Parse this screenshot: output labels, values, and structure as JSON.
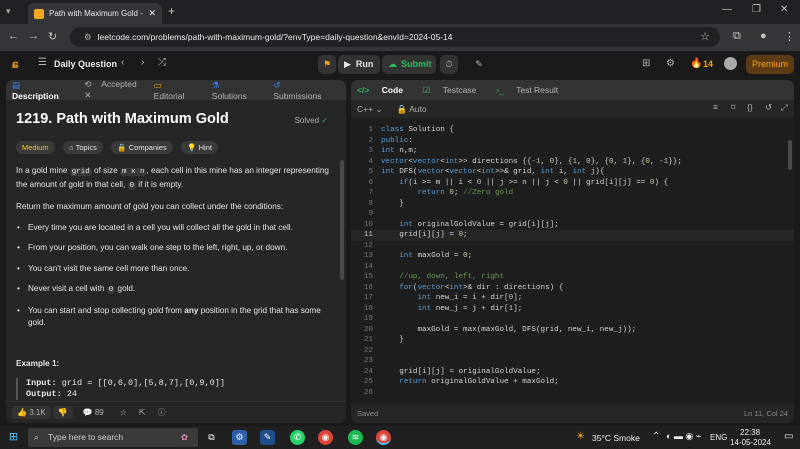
{
  "browser": {
    "tab_title": "Path with Maximum Gold - Leetc",
    "url": "leetcode.com/problems/path-with-maximum-gold/?envType=daily-question&envId=2024-05-14"
  },
  "header": {
    "daily_question": "Daily Question",
    "run": "Run",
    "submit": "Submit",
    "streak": "14",
    "premium": "Premium"
  },
  "left": {
    "tabs": [
      "Description",
      "Accepted",
      "Editorial",
      "Solutions",
      "Submissions"
    ],
    "title": "1219. Path with Maximum Gold",
    "solved": "Solved",
    "chips": [
      "Medium",
      "Topics",
      "Companies",
      "Hint"
    ],
    "para1_a": "In a gold mine ",
    "para1_grid": "grid",
    "para1_b": " of size ",
    "para1_mxn": "m x n",
    "para1_c": ", each cell in this mine has an integer representing the amount of gold in that cell, ",
    "para1_zero": "0",
    "para1_d": " if it is empty.",
    "para2": "Return the maximum amount of gold you can collect under the conditions:",
    "bullets": [
      "Every time you are located in a cell you will collect all the gold in that cell.",
      "From your position, you can walk one step to the left, right, up, or down.",
      "You can't visit the same cell more than once."
    ],
    "bullet4_a": "Never visit a cell with ",
    "bullet4_zero": "0",
    "bullet4_b": " gold.",
    "bullet5_a": "You can start and stop collecting gold from ",
    "bullet5_any": "any",
    "bullet5_b": " position in the grid that has some gold.",
    "example_title": "Example 1:",
    "example_input_label": "Input:",
    "example_input": " grid = [[0,6,0],[5,8,7],[0,9,0]]",
    "example_output_label": "Output:",
    "example_output": " 24",
    "likes": "3.1K",
    "comments": "89"
  },
  "right": {
    "tabs": [
      "Code",
      "Testcase",
      "Test Result"
    ],
    "language": "C++",
    "mode": "Auto",
    "status": "Saved",
    "cursor": "Ln 11, Col 24",
    "code_lines": [
      "class Solution {",
      "public:",
      "int n,m;",
      "vector<vector<int>> directions {{-1, 0}, {1, 0}, {0, 1}, {0, -1}};",
      "int DFS(vector<vector<int>>& grid, int i, int j){",
      "    if(i >= m || i < 0 || j >= n || j < 0 || grid[i][j] == 0) {",
      "        return 0; //Zero gold",
      "    }",
      "",
      "    int originalGoldValue = grid[i][j];",
      "    grid[i][j] = 0;",
      "",
      "    int maxGold = 0;",
      "",
      "    //up, down, left, right",
      "    for(vector<int>& dir : directions) {",
      "        int new_i = i + dir[0];",
      "        int new_j = j + dir[1];",
      "",
      "        maxGold = max(maxGold, DFS(grid, new_i, new_j));",
      "    }",
      "",
      "",
      "    grid[i][j] = originalGoldValue;",
      "    return originalGoldValue + maxGold;",
      ""
    ],
    "line_numbers": [
      "1",
      "2",
      "3",
      "4",
      "5",
      "6",
      "7",
      "8",
      "9",
      "10",
      "11",
      "12",
      "13",
      "14",
      "15",
      "16",
      "17",
      "18",
      "19",
      "20",
      "21",
      "22",
      "23",
      "24",
      "25",
      "26"
    ]
  },
  "taskbar": {
    "search_placeholder": "Type here to search",
    "weather": "35°C  Smoke",
    "lang": "ENG",
    "time": "22:38",
    "date": "14-05-2024"
  }
}
